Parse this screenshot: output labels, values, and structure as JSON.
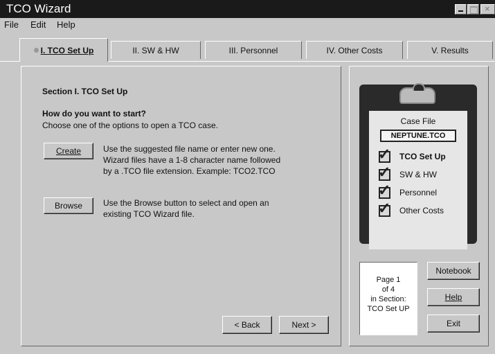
{
  "window": {
    "title": "TCO Wizard",
    "close_glyph": "×"
  },
  "menu": {
    "file": "File",
    "edit": "Edit",
    "help": "Help"
  },
  "tabs": [
    {
      "label": "I. TCO Set Up",
      "active": true
    },
    {
      "label": "II. SW & HW",
      "active": false
    },
    {
      "label": "III. Personnel",
      "active": false
    },
    {
      "label": "IV. Other Costs",
      "active": false
    },
    {
      "label": "V. Results",
      "active": false
    }
  ],
  "main": {
    "section_title": "Section I. TCO Set Up",
    "question": "How do you want to start?",
    "instruction": "Choose one of the options to open a TCO case.",
    "create_label": "Create",
    "create_desc_1": "Use the suggested file name or enter new one.",
    "create_desc_2": "Wizard files have a 1-8 character name followed",
    "create_desc_3": "by a .TCO file extension.  Example: TCO2.TCO",
    "browse_label": "Browse",
    "browse_desc_1": "Use the Browse button to select and open an",
    "browse_desc_2": "existing TCO Wizard file.",
    "back_label": "< Back",
    "next_label": "Next >"
  },
  "clipboard": {
    "case_file_label": "Case File",
    "file_name": "NEPTUNE.TCO",
    "items": [
      {
        "label": "TCO Set Up",
        "current": true
      },
      {
        "label": "SW & HW",
        "current": false
      },
      {
        "label": "Personnel",
        "current": false
      },
      {
        "label": "Other Costs",
        "current": false
      }
    ]
  },
  "page_info": {
    "line1": "Page 1",
    "line2": "of 4",
    "line3": "in Section:",
    "line4": "TCO Set UP"
  },
  "side_buttons": {
    "notebook": "Notebook",
    "help": "Help",
    "exit": "Exit"
  },
  "colors": {
    "titlebar": "#1a1a1a",
    "face": "#c8c8c8",
    "clipboard": "#2a2a2a"
  }
}
